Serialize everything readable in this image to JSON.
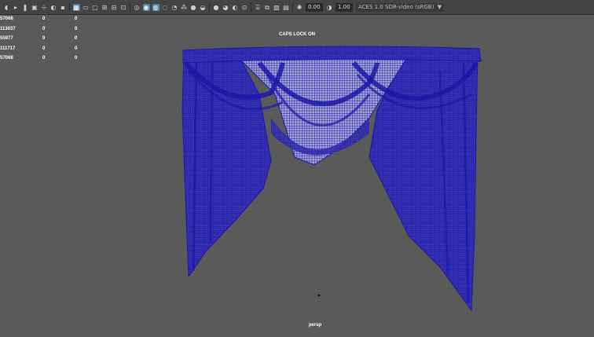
{
  "toolbar": {
    "icons": [
      "camera-icon",
      "camera-attributes-icon",
      "bookmark-icon",
      "image-plane-icon",
      "grid-icon",
      "film-gate-icon",
      "resolution-gate-icon",
      "gate-mask-icon",
      "field-chart-icon",
      "safe-action-icon",
      "safe-title-icon",
      "isolate-select-icon",
      "wireframe-icon",
      "smooth-shade-icon",
      "textured-icon",
      "use-all-lights-icon",
      "shadows-icon",
      "screen-space-ao-icon",
      "motion-blur-icon",
      "antialiasing-icon",
      "depth-of-field-icon",
      "xray-icon",
      "xray-joints-icon",
      "xray-components-icon",
      "isolate-view-icon",
      "exposure-icon",
      "gamma-icon"
    ],
    "exposure_value": "0.00",
    "gamma_value": "1.00",
    "colorspace": "ACES 1.0 SDR-video (sRGB)",
    "colorspace_arrow": "▼"
  },
  "hud": {
    "rows": [
      {
        "label": "57068",
        "c2": "0",
        "c3": "0"
      },
      {
        "label": "113037",
        "c2": "0",
        "c3": "0"
      },
      {
        "label": "55977",
        "c2": "0",
        "c3": "0"
      },
      {
        "label": "111717",
        "c2": "0",
        "c3": "0"
      },
      {
        "label": "57068",
        "c2": "0",
        "c3": "0"
      }
    ]
  },
  "viewport": {
    "caps_lock_message": "CAPS LOCK ON",
    "camera_name": "persp",
    "wireframe_color": "#1c18a6",
    "background_color": "#5a5a5a"
  }
}
